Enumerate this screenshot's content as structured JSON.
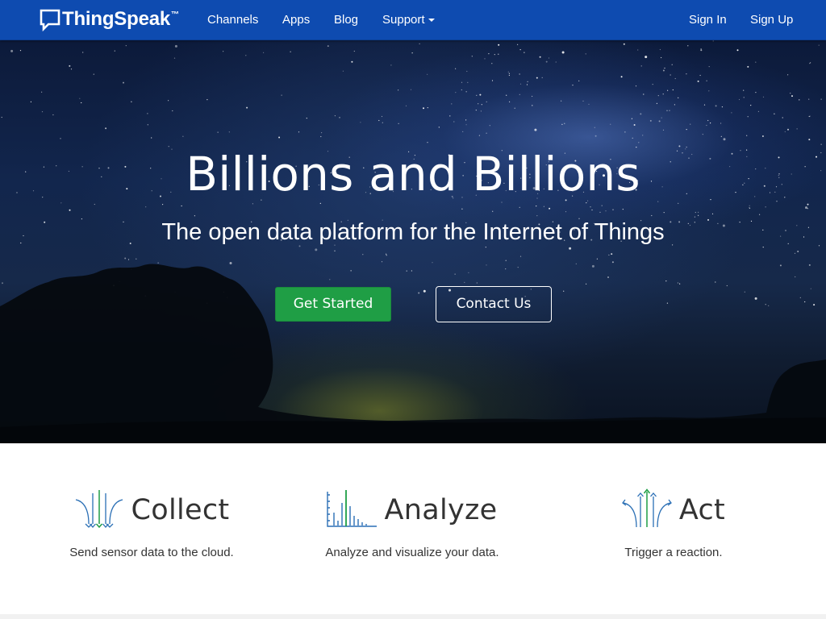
{
  "navbar": {
    "brand": "ThingSpeak",
    "trademark": "™",
    "links": [
      "Channels",
      "Apps",
      "Blog",
      "Support"
    ],
    "right_links": [
      "Sign In",
      "Sign Up"
    ],
    "background_color": "#0e4bb0"
  },
  "hero": {
    "title": "Billions and Billions",
    "subtitle": "The open data platform for the Internet of Things",
    "primary_button": "Get Started",
    "secondary_button": "Contact Us",
    "primary_button_color": "#1f9e45"
  },
  "features": [
    {
      "icon": "collect-arrows-down-icon",
      "title": "Collect",
      "description": "Send sensor data to the cloud."
    },
    {
      "icon": "analyze-bar-chart-icon",
      "title": "Analyze",
      "description": "Analyze and visualize your data."
    },
    {
      "icon": "act-arrows-up-icon",
      "title": "Act",
      "description": "Trigger a reaction."
    }
  ],
  "colors": {
    "accent_blue": "#2a6fb5",
    "accent_green": "#1f9e45",
    "text_dark": "#333333"
  }
}
